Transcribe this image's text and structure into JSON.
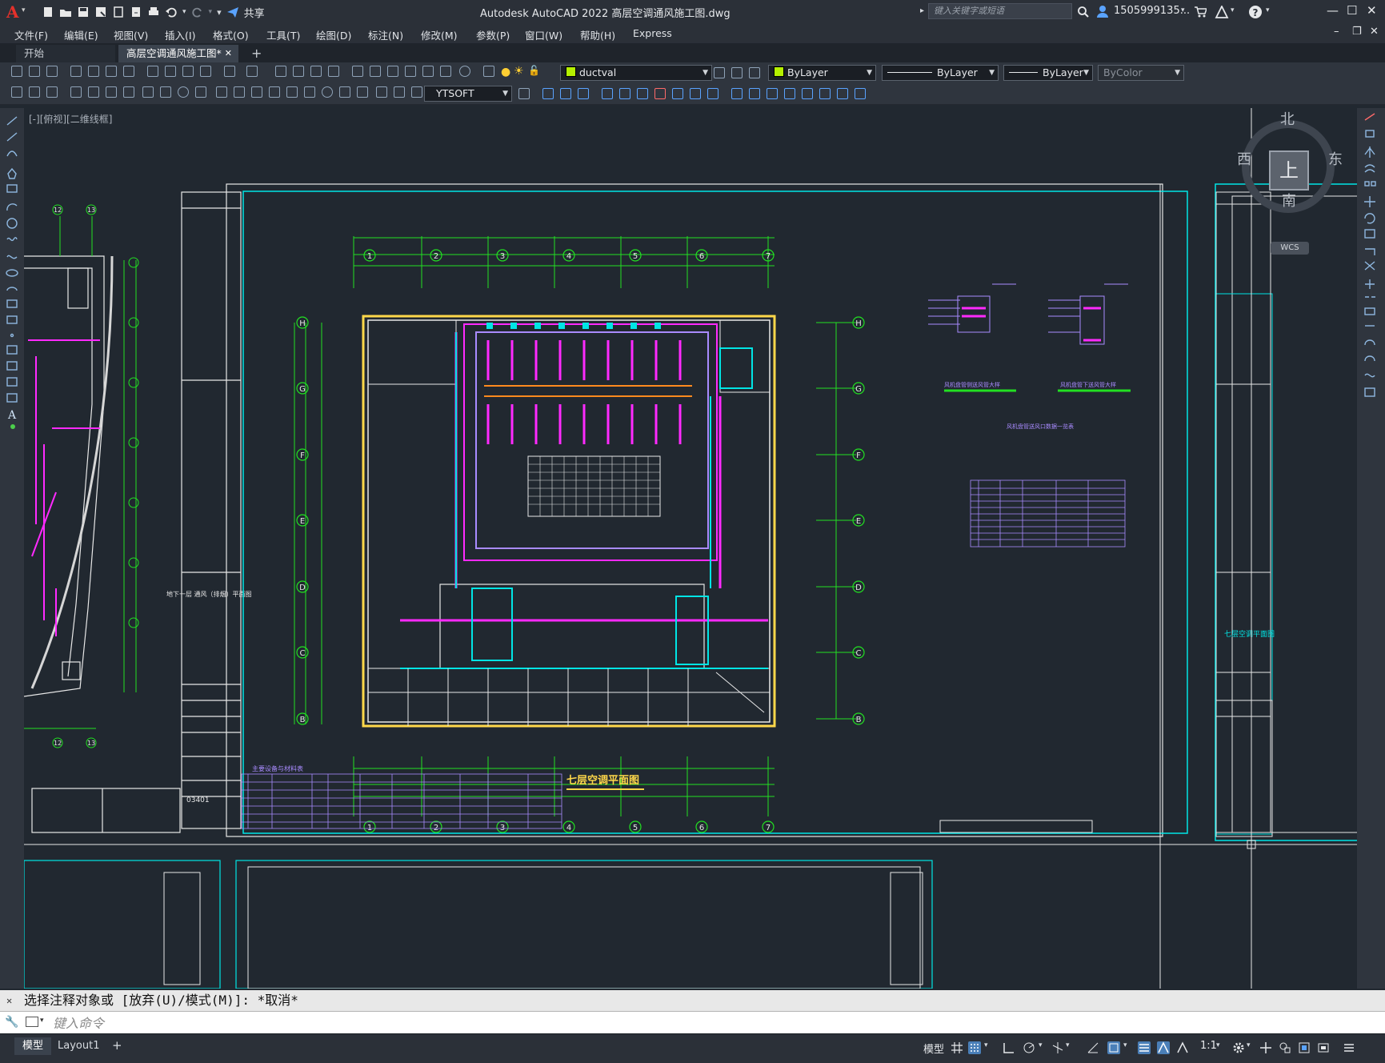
{
  "app": {
    "title": "Autodesk AutoCAD 2022    高层空调通风施工图.dwg",
    "share_label": "共享",
    "search_placeholder": "键入关键字或短语",
    "user": "1505999135...",
    "logo": "A"
  },
  "menu": [
    "文件(F)",
    "编辑(E)",
    "视图(V)",
    "插入(I)",
    "格式(O)",
    "工具(T)",
    "绘图(D)",
    "标注(N)",
    "修改(M)",
    "参数(P)",
    "窗口(W)",
    "帮助(H)",
    "Express"
  ],
  "tabs": {
    "start": "开始",
    "active": "高层空调通风施工图*",
    "close": "✕",
    "add": "+"
  },
  "properties": {
    "layer": "ductval",
    "layer_color": "#b5f000",
    "color": "ByLayer",
    "color_swatch": "#b5f000",
    "linetype": "ByLayer",
    "lineweight": "ByLayer",
    "plotstyle": "ByColor"
  },
  "textstyle": "YTSOFT",
  "viewport_label": "[-][俯视][二维线框]",
  "viewcube": {
    "north": "北",
    "south": "南",
    "east": "东",
    "west": "西",
    "top": "上",
    "wcs": "WCS"
  },
  "drawing": {
    "title_center": "七层空调平面图",
    "title_right": "七层空调平面图",
    "table_title": "主要设备与材料表",
    "detail1": "风机盘管侧送风管大样",
    "detail2": "风机盘管下送风管大样",
    "schedule_title": "风机盘管送风口数据一览表",
    "left_sheet_title": "地下一层\n通风（排烟）平面图",
    "sheet_no": "03401",
    "grid_top": [
      "1",
      "2",
      "3",
      "4",
      "5",
      "6",
      "7"
    ],
    "grid_side": [
      "H",
      "G",
      "F",
      "E",
      "D",
      "C",
      "B"
    ],
    "grid_left_top": [
      "12",
      "13"
    ]
  },
  "command": {
    "history": "选择注释对象或 [放弃(U)/模式(M)]: *取消*",
    "placeholder": "键入命令"
  },
  "status": {
    "tabs": [
      "模型",
      "Layout1"
    ],
    "add": "+",
    "model_label": "模型",
    "scale": "1:1"
  },
  "colors": {
    "cyan": "#00e5e5",
    "magenta": "#ff2aff",
    "yellow": "#ffd84a",
    "white": "#e8e8e8",
    "green": "#22e022",
    "violet": "#a98bff",
    "orange": "#ff8a1e"
  }
}
